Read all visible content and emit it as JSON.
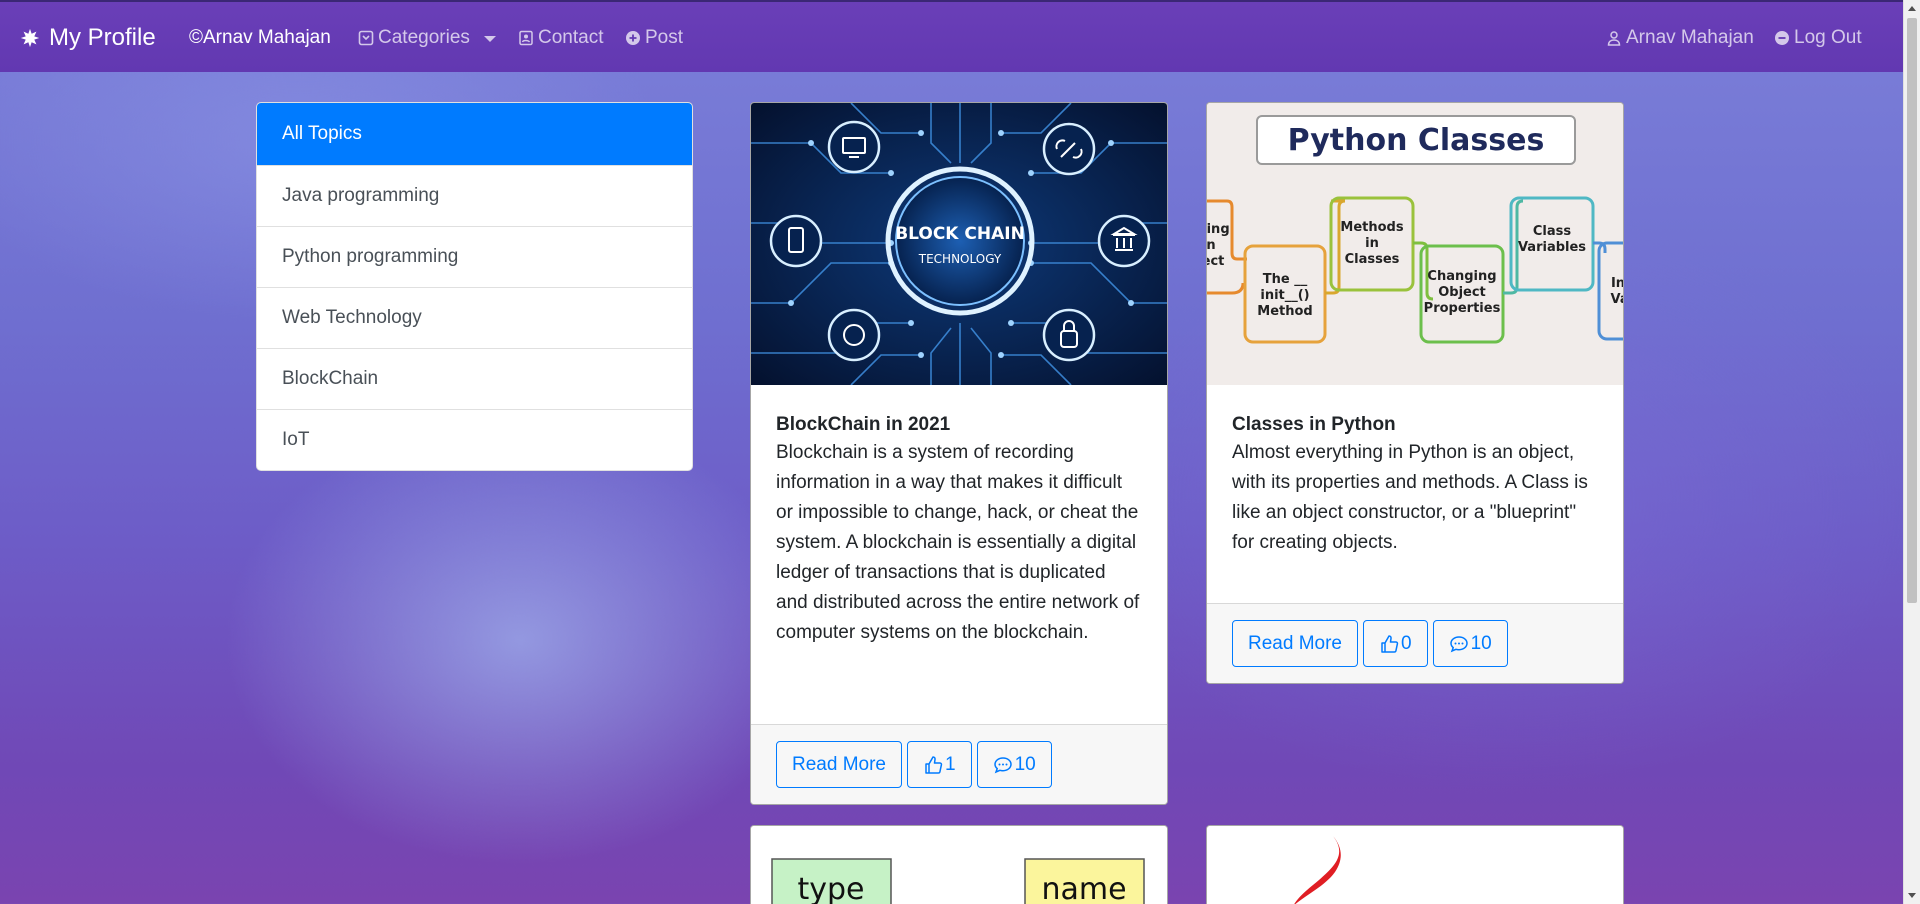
{
  "navbar": {
    "brand": "My Profile",
    "user_link": "©Arnav Mahajan",
    "categories": "Categories",
    "contact": "Contact",
    "post": "Post",
    "profile": "Arnav Mahajan",
    "logout": "Log Out"
  },
  "topics": [
    {
      "label": "All Topics",
      "active": true
    },
    {
      "label": "Java programming"
    },
    {
      "label": "Python programming"
    },
    {
      "label": "Web Technology"
    },
    {
      "label": "BlockChain"
    },
    {
      "label": "IoT"
    }
  ],
  "posts": [
    {
      "image_text": [
        "BLOCK CHAIN",
        "TECHNOLOGY"
      ],
      "title": "BlockChain in 2021",
      "content": "Blockchain is a system of recording information in a way that makes it difficult or impossible to change, hack, or cheat the system. A blockchain is essentially a digital ledger of transactions that is duplicated and distributed across the entire network of computer systems on the blockchain.",
      "read_more": "Read More",
      "likes": "1",
      "comments": "10"
    },
    {
      "image_text": {
        "heading": "Python Classes",
        "boxes": [
          "ting",
          "n",
          "ect",
          "The __",
          "init__()",
          "Method",
          "Methods",
          "in",
          "Classes",
          "Changing",
          "Object",
          "Properties",
          "Class",
          "Variables",
          "Inst",
          "Vari"
        ]
      },
      "title": "Classes in Python",
      "content": "Almost everything in Python is an object, with its properties and methods. A Class is like an object constructor, or a \"blueprint\" for creating objects.",
      "read_more": "Read More",
      "likes": "0",
      "comments": "10"
    },
    {
      "image_text": [
        "type",
        "name"
      ]
    },
    {}
  ],
  "colors": {
    "navbar": "#6238b1",
    "primary": "#007bff",
    "active_topic": "#007bff"
  }
}
